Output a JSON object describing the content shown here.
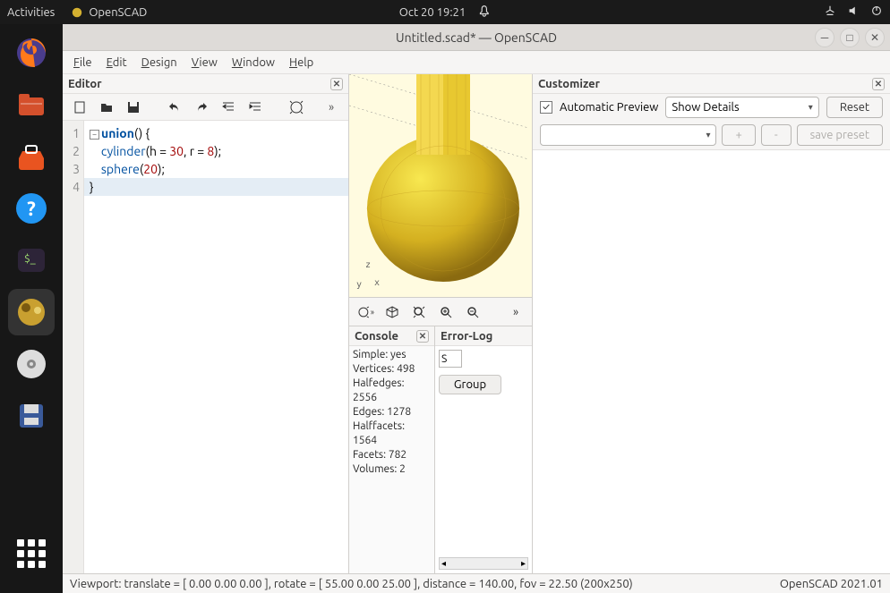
{
  "topbar": {
    "activities": "Activities",
    "appname": "OpenSCAD",
    "datetime": "Oct 20  19:21"
  },
  "window": {
    "title": "Untitled.scad* — OpenSCAD"
  },
  "menubar": [
    "File",
    "Edit",
    "Design",
    "View",
    "Window",
    "Help"
  ],
  "editor": {
    "title": "Editor",
    "lines": [
      {
        "n": "1"
      },
      {
        "n": "2"
      },
      {
        "n": "3"
      },
      {
        "n": "4"
      }
    ],
    "code": {
      "l1_kw": "union",
      "l1_rest": "() {",
      "l2_fn": "cylinder",
      "l2_args_a": "(h = ",
      "l2_num1": "30",
      "l2_mid": ", r = ",
      "l2_num2": "8",
      "l2_end": ");",
      "l3_fn": "sphere",
      "l3_open": "(",
      "l3_num": "20",
      "l3_end": ");",
      "l4": "}"
    }
  },
  "console": {
    "title": "Console",
    "body": [
      "   Simple: yes",
      "   Vertices: 498",
      "   Halfedges:   2556",
      "   Edges: 1278",
      "   Halffacets:   1564",
      "   Facets: 782",
      "   Volumes:         2"
    ]
  },
  "errorlog": {
    "title": "Error-Log",
    "filter": "S",
    "group": "Group"
  },
  "customizer": {
    "title": "Customizer",
    "autopreview": "Automatic Preview",
    "details": "Show Details",
    "reset": "Reset",
    "plus": "+",
    "minus": "-",
    "save": "save preset"
  },
  "statusbar": {
    "left": "Viewport: translate = [ 0.00 0.00 0.00 ], rotate = [ 55.00 0.00 25.00 ], distance = 140.00, fov = 22.50 (200x250)",
    "right": "OpenSCAD 2021.01"
  }
}
